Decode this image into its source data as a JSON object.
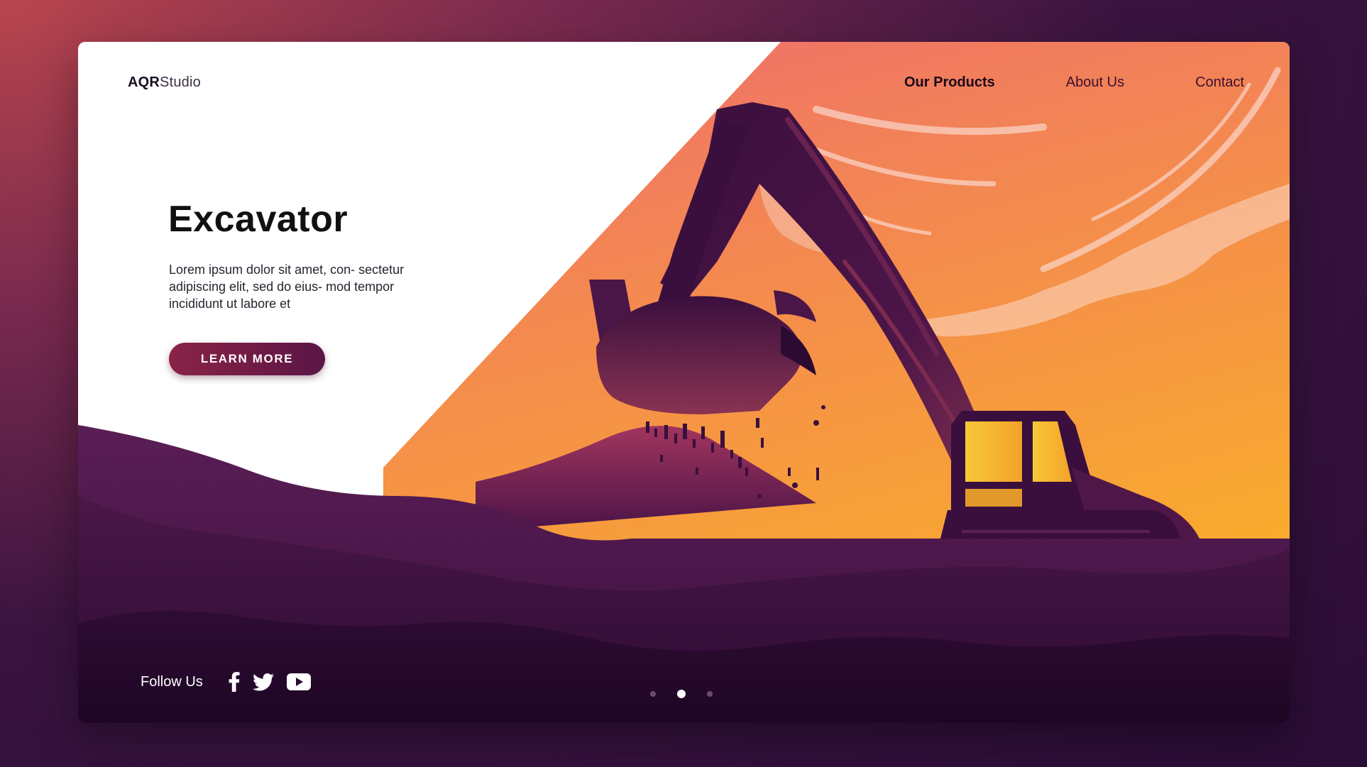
{
  "header": {
    "logo_brand": "AQR",
    "logo_suffix": "Studio",
    "nav": [
      {
        "label": "Our Products",
        "active": true
      },
      {
        "label": "About Us",
        "active": false
      },
      {
        "label": "Contact",
        "active": false
      }
    ]
  },
  "hero": {
    "title": "Excavator",
    "body": "Lorem ipsum dolor sit amet, con- sectetur adipiscing elit, sed do eius- mod tempor incididunt ut labore et",
    "cta_label": "LEARN MORE"
  },
  "footer": {
    "follow_label": "Follow Us",
    "social_icons": [
      "facebook-icon",
      "twitter-icon",
      "youtube-icon"
    ]
  },
  "carousel": {
    "total_slides": 3,
    "active_slide": 2
  },
  "colors": {
    "background_dark": "#2a0c36",
    "background_accent": "#b8454e",
    "sky_top": "#f0706a",
    "sky_bottom": "#f8a52a",
    "silhouette": "#3a0f3e",
    "button": "#7a1f46",
    "cab_window": "#f6b92a"
  }
}
